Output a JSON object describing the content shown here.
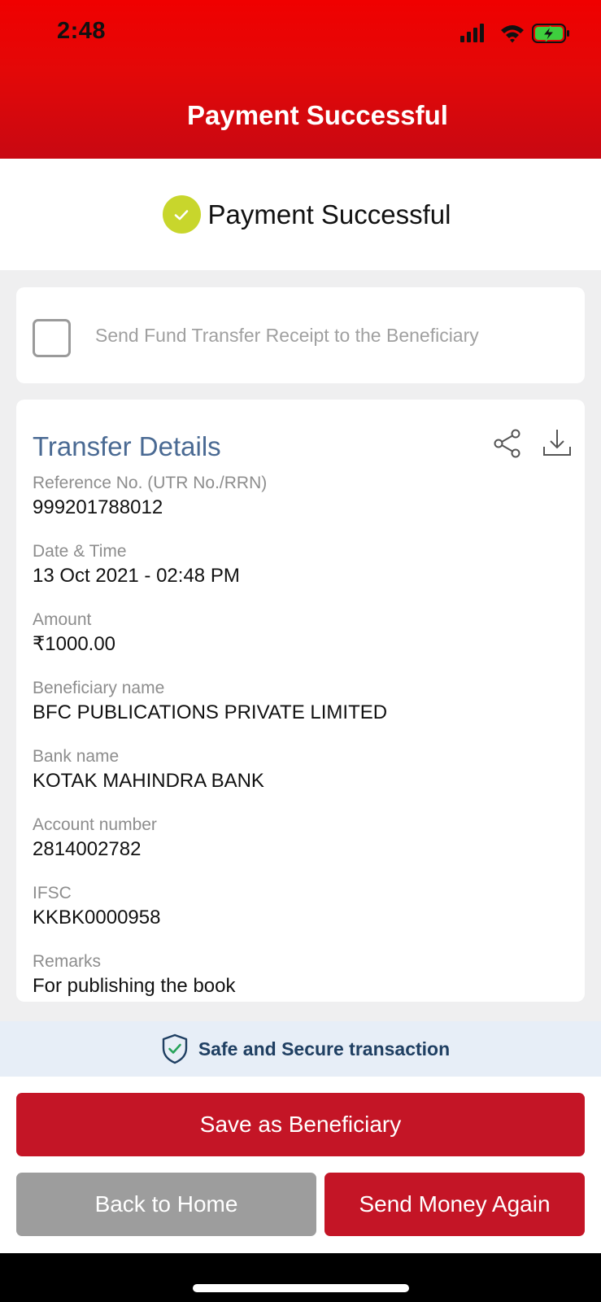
{
  "status_bar": {
    "time": "2:48",
    "icons": [
      "signal-icon",
      "wifi-icon",
      "battery-charging-icon"
    ]
  },
  "header": {
    "title": "Payment Successful"
  },
  "banner": {
    "text": "Payment Successful",
    "icon": "check-circle-icon",
    "icon_color": "#c8d62c"
  },
  "receipt": {
    "label": "Send Fund Transfer Receipt to the Beneficiary",
    "checked": false
  },
  "details": {
    "title": "Transfer Details",
    "actions": [
      "share-icon",
      "download-icon"
    ],
    "fields": [
      {
        "label": "Reference No. (UTR No./RRN)",
        "value": "999201788012"
      },
      {
        "label": "Date & Time",
        "value": "13 Oct 2021 - 02:48 PM"
      },
      {
        "label": "Amount",
        "value": "₹1000.00"
      },
      {
        "label": "Beneficiary name",
        "value": "BFC PUBLICATIONS PRIVATE LIMITED"
      },
      {
        "label": "Bank name",
        "value": "KOTAK MAHINDRA BANK"
      },
      {
        "label": "Account number",
        "value": "2814002782"
      },
      {
        "label": "IFSC",
        "value": "KKBK0000958"
      },
      {
        "label": "Remarks",
        "value": "For publishing the book"
      }
    ]
  },
  "secure": {
    "text": "Safe and Secure transaction",
    "icon": "shield-check-icon"
  },
  "buttons": {
    "save_beneficiary": "Save as Beneficiary",
    "back_home": "Back to Home",
    "send_again": "Send Money Again"
  },
  "colors": {
    "header_red": "#e30808",
    "primary_button": "#c41526",
    "secondary_button": "#9d9d9d",
    "details_title": "#4a6a93"
  }
}
